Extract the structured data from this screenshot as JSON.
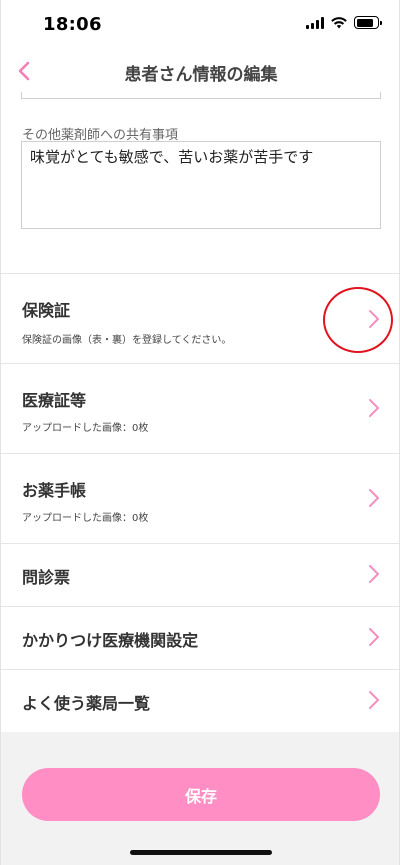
{
  "status_bar": {
    "time": "18:06"
  },
  "header": {
    "title": "患者さん情報の編集"
  },
  "form": {
    "note_label": "その他薬剤師への共有事項",
    "note_value": "味覚がとても敏感で、苦いお薬が苦手です"
  },
  "list": {
    "items": [
      {
        "title": "保険証",
        "subtitle": "保険証の画像（表・裏）を登録してください。"
      },
      {
        "title": "医療証等",
        "subtitle": "アップロードした画像：0枚"
      },
      {
        "title": "お薬手帳",
        "subtitle": "アップロードした画像：0枚"
      },
      {
        "title": "問診票"
      },
      {
        "title": "かかりつけ医療機関設定"
      },
      {
        "title": "よく使う薬局一覧"
      }
    ]
  },
  "footer": {
    "save_label": "保存"
  },
  "colors": {
    "accent": "#fe8ec3",
    "highlight": "#e0141f"
  },
  "icons": [
    "back-chevron-icon",
    "chevron-right-icon",
    "signal-icon",
    "wifi-icon",
    "battery-icon"
  ]
}
